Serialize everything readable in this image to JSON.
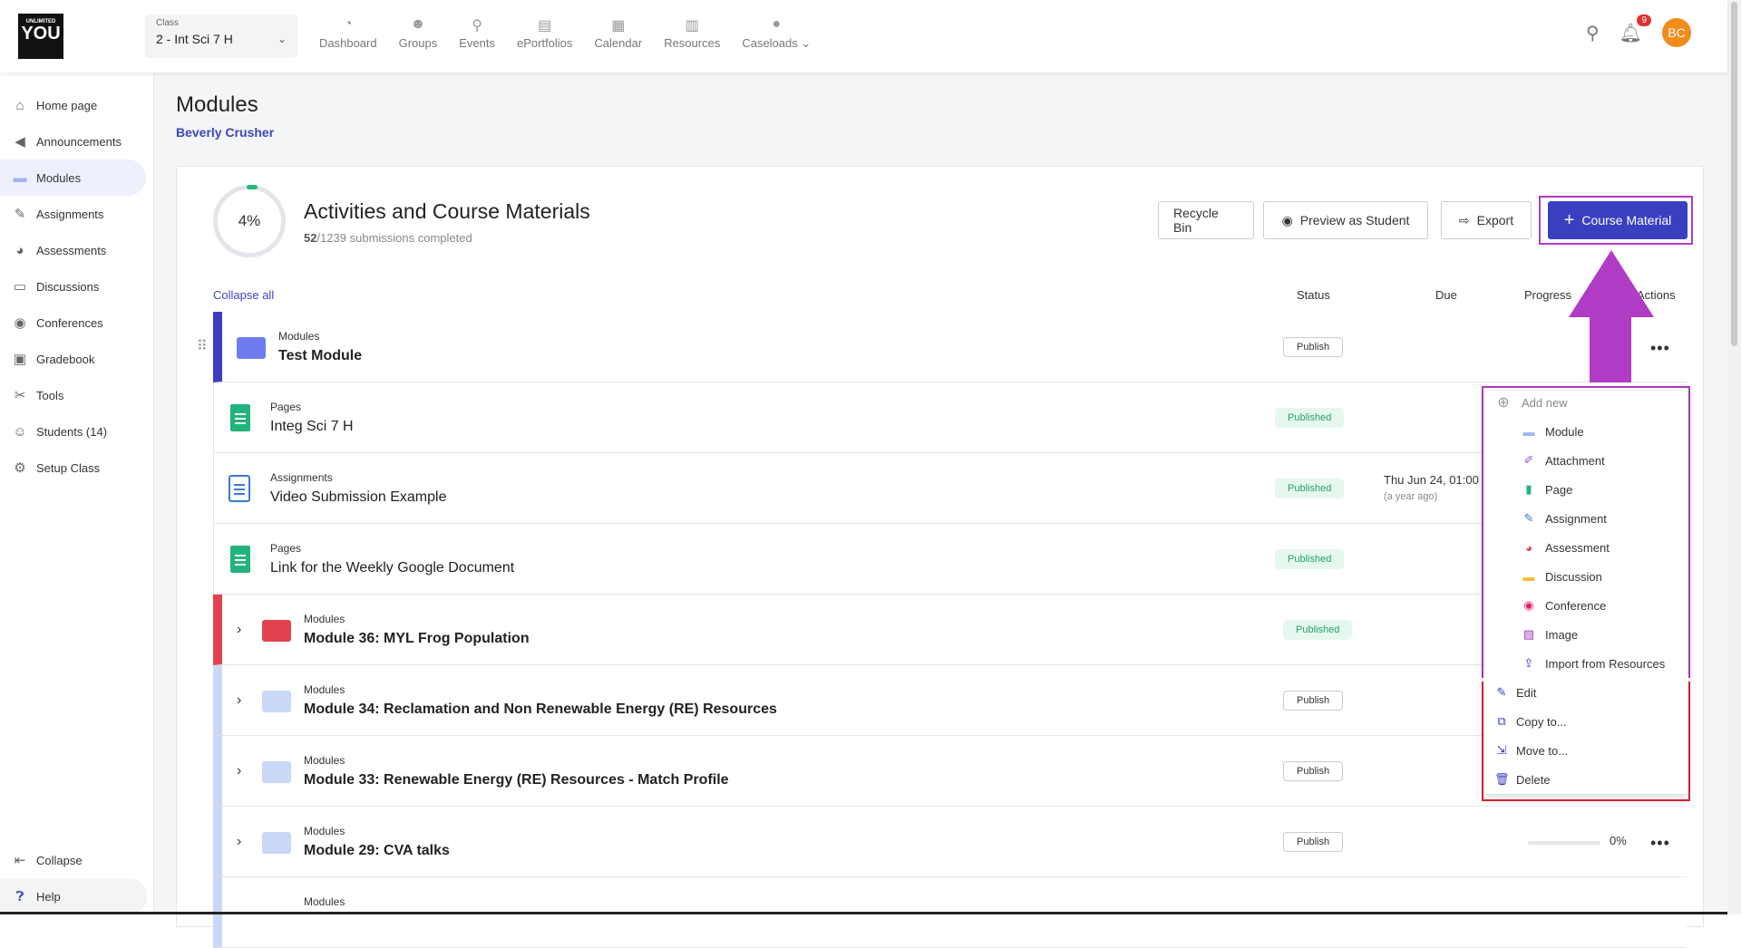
{
  "app": {
    "logo_line1": "UNLIMITED",
    "logo_line2": "YOU"
  },
  "class_selector": {
    "label": "Class",
    "value": "2 - Int Sci 7 H"
  },
  "nav": [
    {
      "label": "Dashboard",
      "icon": "dashboard-icon"
    },
    {
      "label": "Groups",
      "icon": "groups-icon"
    },
    {
      "label": "Events",
      "icon": "events-icon"
    },
    {
      "label": "ePortfolios",
      "icon": "eportfolios-icon"
    },
    {
      "label": "Calendar",
      "icon": "calendar-icon"
    },
    {
      "label": "Resources",
      "icon": "resources-icon"
    },
    {
      "label": "Caseloads",
      "icon": "caseloads-icon"
    }
  ],
  "topright": {
    "notifications": "9",
    "avatar": "BC"
  },
  "sidebar": {
    "items": [
      {
        "label": "Home page",
        "icon": "home-icon"
      },
      {
        "label": "Announcements",
        "icon": "megaphone-icon"
      },
      {
        "label": "Modules",
        "icon": "modules-icon"
      },
      {
        "label": "Assignments",
        "icon": "assignment-icon"
      },
      {
        "label": "Assessments",
        "icon": "assessment-icon"
      },
      {
        "label": "Discussions",
        "icon": "discussion-icon"
      },
      {
        "label": "Conferences",
        "icon": "conference-icon"
      },
      {
        "label": "Gradebook",
        "icon": "gradebook-icon"
      },
      {
        "label": "Tools",
        "icon": "tools-icon"
      },
      {
        "label": "Students (14)",
        "icon": "students-icon"
      },
      {
        "label": "Setup Class",
        "icon": "setup-icon"
      }
    ],
    "collapse": "Collapse",
    "help": "Help"
  },
  "page": {
    "title": "Modules",
    "subtitle": "Beverly Crusher"
  },
  "card": {
    "progress_percent": "4%",
    "title": "Activities and Course Materials",
    "completed": "52",
    "completed_suffix": "/1239 submissions completed",
    "buttons": {
      "recycle": "Recycle Bin",
      "preview": "Preview as Student",
      "export": "Export",
      "course_material": "Course Material"
    },
    "collapse_all": "Collapse all",
    "headers": {
      "status": "Status",
      "due": "Due",
      "progress": "Progress",
      "actions": "Actions"
    }
  },
  "rows": [
    {
      "category": "Modules",
      "name": "Test Module",
      "status": "Publish"
    },
    {
      "category": "Pages",
      "name": "Integ Sci 7 H",
      "status": "Published"
    },
    {
      "category": "Assignments",
      "name": "Video Submission Example",
      "status": "Published",
      "due": "Thu Jun 24, 01:00",
      "due_rel": "(a year ago)"
    },
    {
      "category": "Pages",
      "name": "Link for the Weekly Google Document",
      "status": "Published"
    },
    {
      "category": "Modules",
      "name": "Module 36: MYL Frog Population",
      "status": "Published"
    },
    {
      "category": "Modules",
      "name": "Module 34: Reclamation and Non Renewable Energy (RE) Resources",
      "status": "Publish"
    },
    {
      "category": "Modules",
      "name": "Module 33: Renewable Energy (RE) Resources - Match Profile",
      "status": "Publish"
    },
    {
      "category": "Modules",
      "name": "Module 29: CVA talks",
      "status": "Publish",
      "progress": "0%"
    },
    {
      "category": "Modules"
    }
  ],
  "menu": {
    "add_new": "Add new",
    "items": [
      "Module",
      "Attachment",
      "Page",
      "Assignment",
      "Assessment",
      "Discussion",
      "Conference",
      "Image",
      "Import from Resources"
    ],
    "actions": [
      "Edit",
      "Copy to...",
      "Move to...",
      "Delete"
    ]
  },
  "colors": {
    "accent": "#3a3fc0",
    "highlight_purple": "#b03bc4",
    "highlight_red": "#e0203a",
    "published_green": "#25a06a"
  }
}
